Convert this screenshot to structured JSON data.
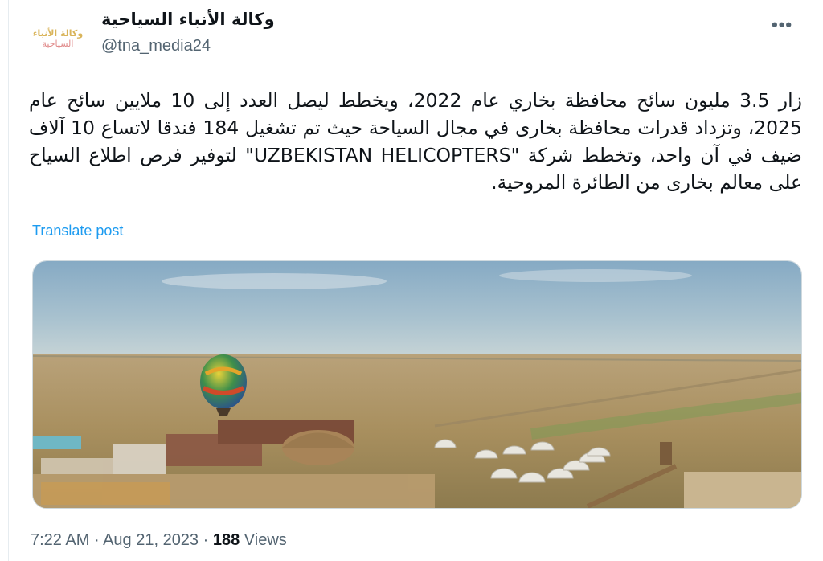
{
  "account": {
    "display_name": "وكالة الأنباء السياحية",
    "handle": "@tna_media24",
    "avatar_logo_text_line1": "وكالة الأنباء",
    "avatar_logo_text_line2": "السياحية"
  },
  "tweet": {
    "text": "زار 3.5 مليون سائح محافظة بخاري عام 2022، ويخطط ليصل العدد إلى 10 ملايين سائح عام 2025، وتزداد قدرات محافظة بخارى في مجال السياحة حيث تم تشغيل 184 فندقا لاتساع 10 آلاف ضيف في آن واحد، وتخطط شركة \"UZBEKISTAN HELICOPTERS\" لتوفير فرص اطلاع السياح على معالم بخارى من الطائرة المروحية.",
    "translate_label": "Translate post",
    "more_icon": "more-horizontal-icon"
  },
  "footer": {
    "time": "7:22 AM",
    "separator": " · ",
    "date": "Aug 21, 2023",
    "views_count": "188",
    "views_label": " Views"
  },
  "colors": {
    "link": "#1d9bf0",
    "secondary_text": "#536471",
    "primary_text": "#0f1419"
  }
}
